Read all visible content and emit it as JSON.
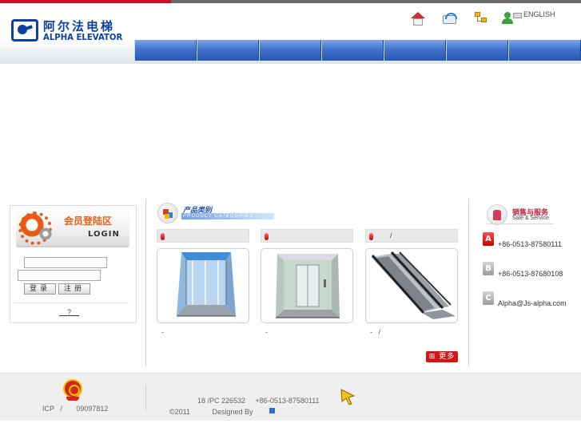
{
  "header": {
    "logo": {
      "chinese_name": "阿尔法电梯",
      "english_name": "ALPHA ELEVATOR"
    },
    "top_links": {
      "home_icon": "home-icon",
      "mail_icon": "mail-icon",
      "sitemap_icon": "sitemap-icon",
      "language_icon": "user-flag-icon",
      "language_label": "ENGLISH"
    },
    "nav_tabs": [
      "",
      "",
      "",
      "",
      "",
      "",
      ""
    ]
  },
  "login": {
    "title_cn": "会员登陆区",
    "title_en": "LOGIN",
    "username_value": "",
    "password_value": "",
    "login_button": "登录",
    "register_button": "注册",
    "forgot_link": "__?__"
  },
  "products": {
    "title_cn": "产品类别",
    "title_en": "PRODUCT CATEGORIES",
    "items": [
      {
        "bar_text": "",
        "caption": "-"
      },
      {
        "bar_text": "",
        "caption": "-"
      },
      {
        "bar_text": "/",
        "caption": "-   /"
      }
    ],
    "more_label": "更多",
    "more_icon": "plus-box-icon"
  },
  "sales": {
    "title_cn": "销售与服务",
    "title_en": "Sale & Service",
    "contacts": [
      {
        "badge": "A",
        "text": "+86-0513-87580111"
      },
      {
        "badge": "B",
        "text": "+86-0513-87680108"
      },
      {
        "badge": "C",
        "text": "Alpha@Js-alpha.com"
      }
    ]
  },
  "footer": {
    "icp": "ICP   /       09097812",
    "address_line": "18 /PC 226532     +86-0513-87580111",
    "copyright_line": "©2011           Designed By"
  },
  "colors": {
    "brand_blue": "#0a3fa3",
    "nav_blue": "#2857b4",
    "accent_red": "#d01818",
    "login_orange": "#e8611a"
  }
}
